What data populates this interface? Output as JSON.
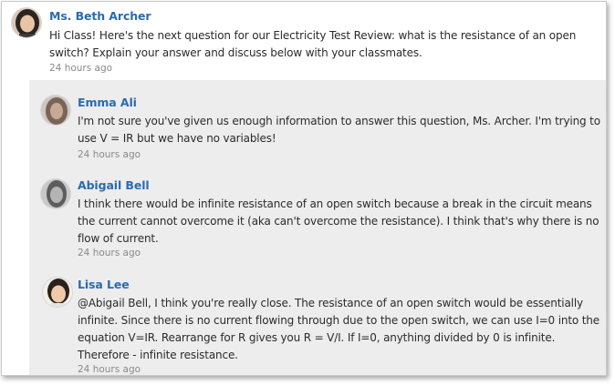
{
  "post": {
    "author": "Ms. Beth Archer",
    "lines": [
      "Hi Class! Here's the next question for our Electricity Test Review: what is the resistance of an open",
      "switch? Explain your answer and discuss below with your classmates."
    ],
    "time": "24 hours ago"
  },
  "replies": [
    {
      "author": "Emma Ali",
      "lines": [
        "I'm not sure you've given us enough information to answer this question, Ms. Archer. I'm trying to",
        "use V = IR but we have no variables!"
      ],
      "time": "24 hours ago"
    },
    {
      "author": "Abigail Bell",
      "lines": [
        "I think there would be infinite resistance of an open switch because a break in the circuit means",
        "the current cannot overcome it (aka can't overcome the resistance). I think that's why there is no",
        "flow of current."
      ],
      "time": "24 hours ago"
    },
    {
      "author": "Lisa Lee",
      "lines": [
        "@Abigail Bell, I think you're really close. The resistance of an open switch would be essentially",
        "infinite. Since there is no current flowing through due to the open switch, we can use I=0 into the",
        "equation V=IR. Rearrange for R gives you R = V/I. If I=0, anything divided by 0 is infinite.",
        "Therefore - infinite resistance."
      ],
      "time": "24 hours ago"
    }
  ],
  "colors": {
    "author": "#2a6bb0",
    "reply_background": "#ededed",
    "timestamp": "#8a8a8a"
  }
}
